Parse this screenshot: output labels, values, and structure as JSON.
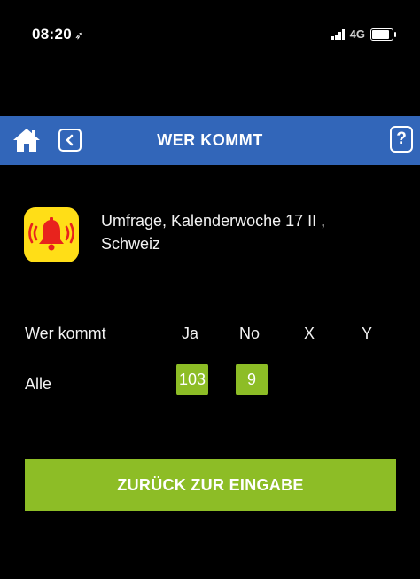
{
  "status_bar": {
    "time": "08:20",
    "location_glyph": "➶",
    "network": "4G"
  },
  "header": {
    "title": "WER KOMMT",
    "home_icon": "home-icon",
    "back_icon": "back-chevron-icon",
    "help_label": "?",
    "background_color": "#3266b9"
  },
  "survey": {
    "icon": "alarm-bell-icon",
    "title_line1": "Umfrage, Kalenderwoche 17 II ,",
    "title_line2": "Schweiz"
  },
  "results_table": {
    "columns": [
      "Wer kommt",
      "Ja",
      "No",
      "X",
      "Y"
    ],
    "rows": [
      {
        "label": "Alle",
        "ja": "103",
        "no": "9",
        "x": "",
        "y": ""
      }
    ],
    "badge_color": "#8dbd26"
  },
  "actions": {
    "back_to_input_label": "ZURÜCK ZUR EINGABE"
  }
}
